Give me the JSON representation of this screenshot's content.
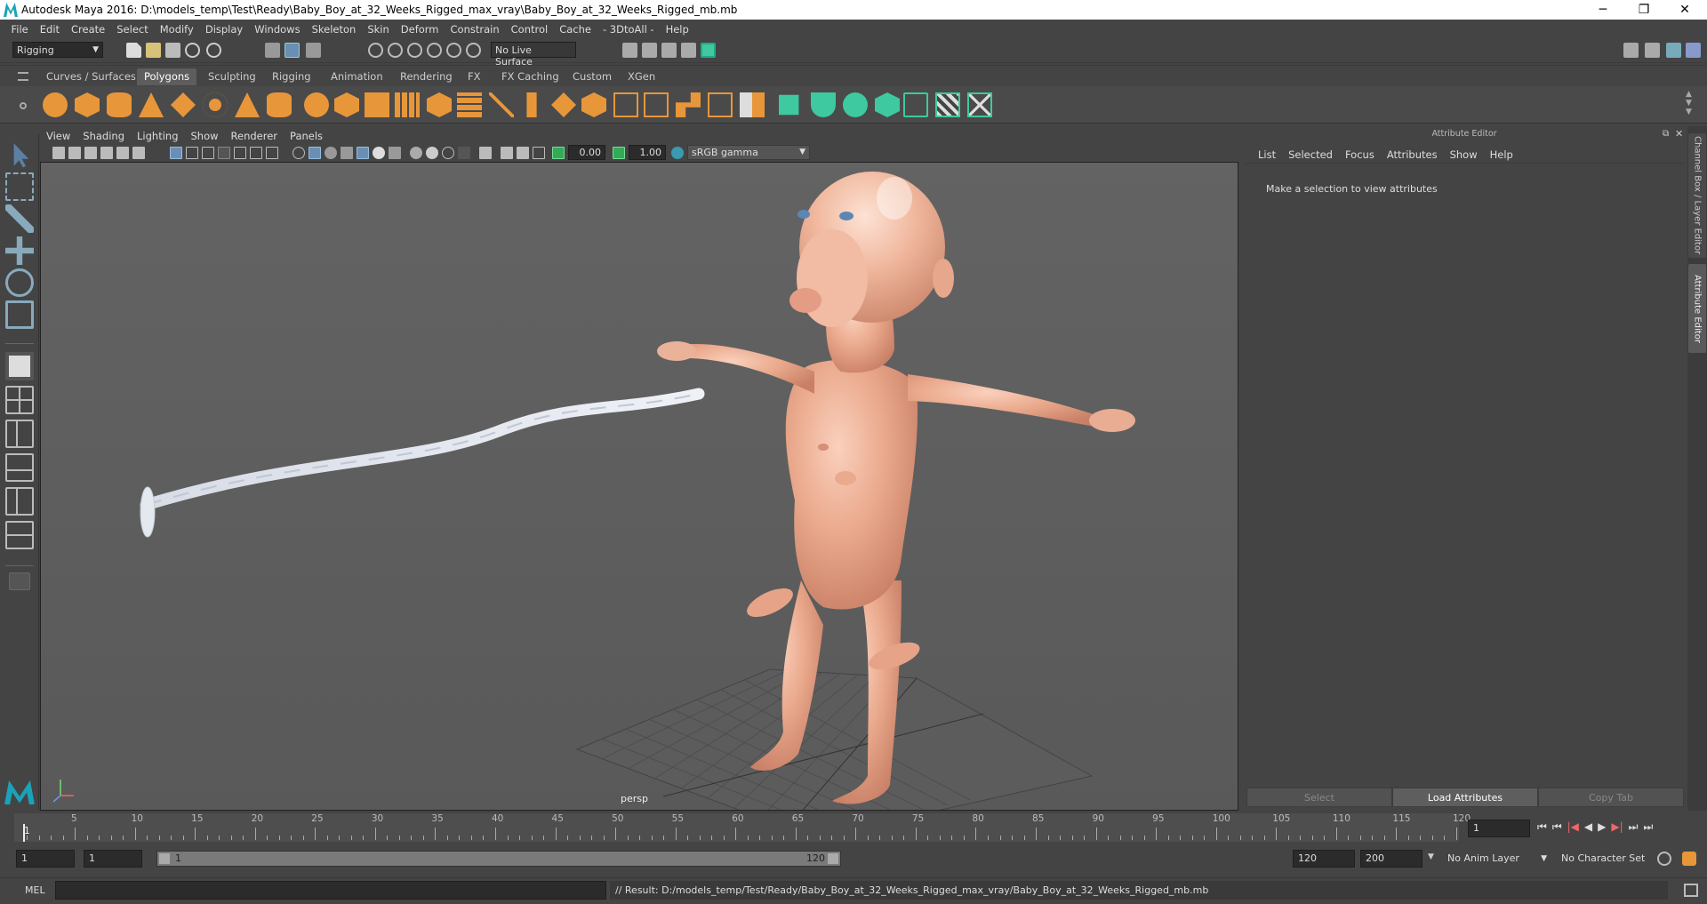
{
  "title": "Autodesk Maya 2016: D:\\models_temp\\Test\\Ready\\Baby_Boy_at_32_Weeks_Rigged_max_vray\\Baby_Boy_at_32_Weeks_Rigged_mb.mb",
  "window_controls": {
    "minimize": "─",
    "maximize": "❐",
    "close": "✕"
  },
  "menu": [
    "File",
    "Edit",
    "Create",
    "Select",
    "Modify",
    "Display",
    "Windows",
    "Skeleton",
    "Skin",
    "Deform",
    "Constrain",
    "Control",
    "Cache",
    "- 3DtoAll -",
    "Help"
  ],
  "status": {
    "menuset": "Rigging",
    "live_surface": "No Live Surface"
  },
  "shelf_tabs": [
    "Curves / Surfaces",
    "Polygons",
    "Sculpting",
    "Rigging",
    "Animation",
    "Rendering",
    "FX",
    "FX Caching",
    "Custom",
    "XGen"
  ],
  "shelf_active": "Polygons",
  "viewport": {
    "menu": [
      "View",
      "Shading",
      "Lighting",
      "Show",
      "Renderer",
      "Panels"
    ],
    "exposure": "0.00",
    "gamma": "1.00",
    "colorspace": "sRGB gamma",
    "camera": "persp"
  },
  "attribute_editor": {
    "header": "Attribute Editor",
    "menu": [
      "List",
      "Selected",
      "Focus",
      "Attributes",
      "Show",
      "Help"
    ],
    "message": "Make a selection to view attributes",
    "buttons": [
      "Select",
      "Load Attributes",
      "Copy Tab"
    ]
  },
  "side_tabs": [
    "Channel Box / Layer Editor",
    "Attribute Editor"
  ],
  "timeline": {
    "ticks": [
      "5",
      "10",
      "15",
      "20",
      "25",
      "30",
      "35",
      "40",
      "45",
      "50",
      "55",
      "60",
      "65",
      "70",
      "75",
      "80",
      "85",
      "90",
      "95",
      "100",
      "105",
      "110",
      "115",
      "120"
    ],
    "start_label": "1",
    "current_frame": "1"
  },
  "range": {
    "start": "1",
    "playback_start": "1",
    "slider_left": "1",
    "slider_right": "120",
    "playback_end": "120",
    "end": "200",
    "anim_layer": "No Anim Layer",
    "character_set": "No Character Set"
  },
  "command": {
    "label": "MEL",
    "result": "// Result: D:/models_temp/Test/Ready/Baby_Boy_at_32_Weeks_Rigged_max_vray/Baby_Boy_at_32_Weeks_Rigged_mb.mb"
  },
  "colors": {
    "accent_orange": "#e8963a",
    "accent_green": "#3ec9a0",
    "maya_teal": "#1aa3b8"
  }
}
